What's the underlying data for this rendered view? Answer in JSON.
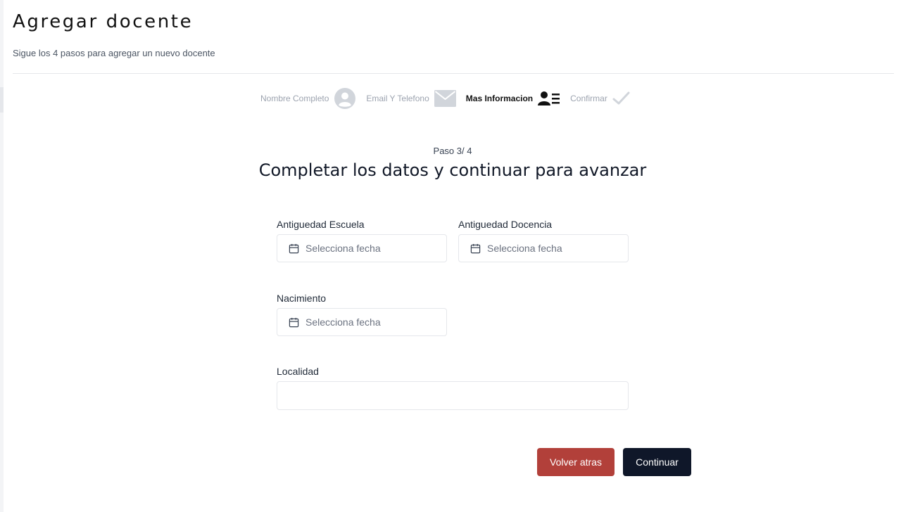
{
  "header": {
    "title": "Agregar docente",
    "subtitle": "Sigue los 4 pasos para agregar un nuevo docente"
  },
  "stepper": {
    "steps": [
      {
        "label": "Nombre Completo",
        "icon": "user-circle-icon",
        "state": "done"
      },
      {
        "label": "Email Y Telefono",
        "icon": "envelope-icon",
        "state": "done"
      },
      {
        "label": "Mas Informacion",
        "icon": "user-list-icon",
        "state": "active"
      },
      {
        "label": "Confirmar",
        "icon": "check-icon",
        "state": "pending"
      }
    ]
  },
  "form": {
    "step_counter": "Paso 3/ 4",
    "heading": "Completar los datos y continuar para avanzar",
    "fields": {
      "antiguedad_escuela": {
        "label": "Antiguedad Escuela",
        "placeholder": "Selecciona fecha"
      },
      "antiguedad_docencia": {
        "label": "Antiguedad Docencia",
        "placeholder": "Selecciona fecha"
      },
      "nacimiento": {
        "label": "Nacimiento",
        "placeholder": "Selecciona fecha"
      },
      "localidad": {
        "label": "Localidad",
        "value": ""
      }
    }
  },
  "actions": {
    "back_label": "Volver atras",
    "next_label": "Continuar"
  },
  "colors": {
    "back_button": "#b2403a",
    "next_button": "#0f1729",
    "inactive_step": "#9ca3af",
    "inactive_icon": "#d1d5db",
    "active_step": "#111111"
  }
}
